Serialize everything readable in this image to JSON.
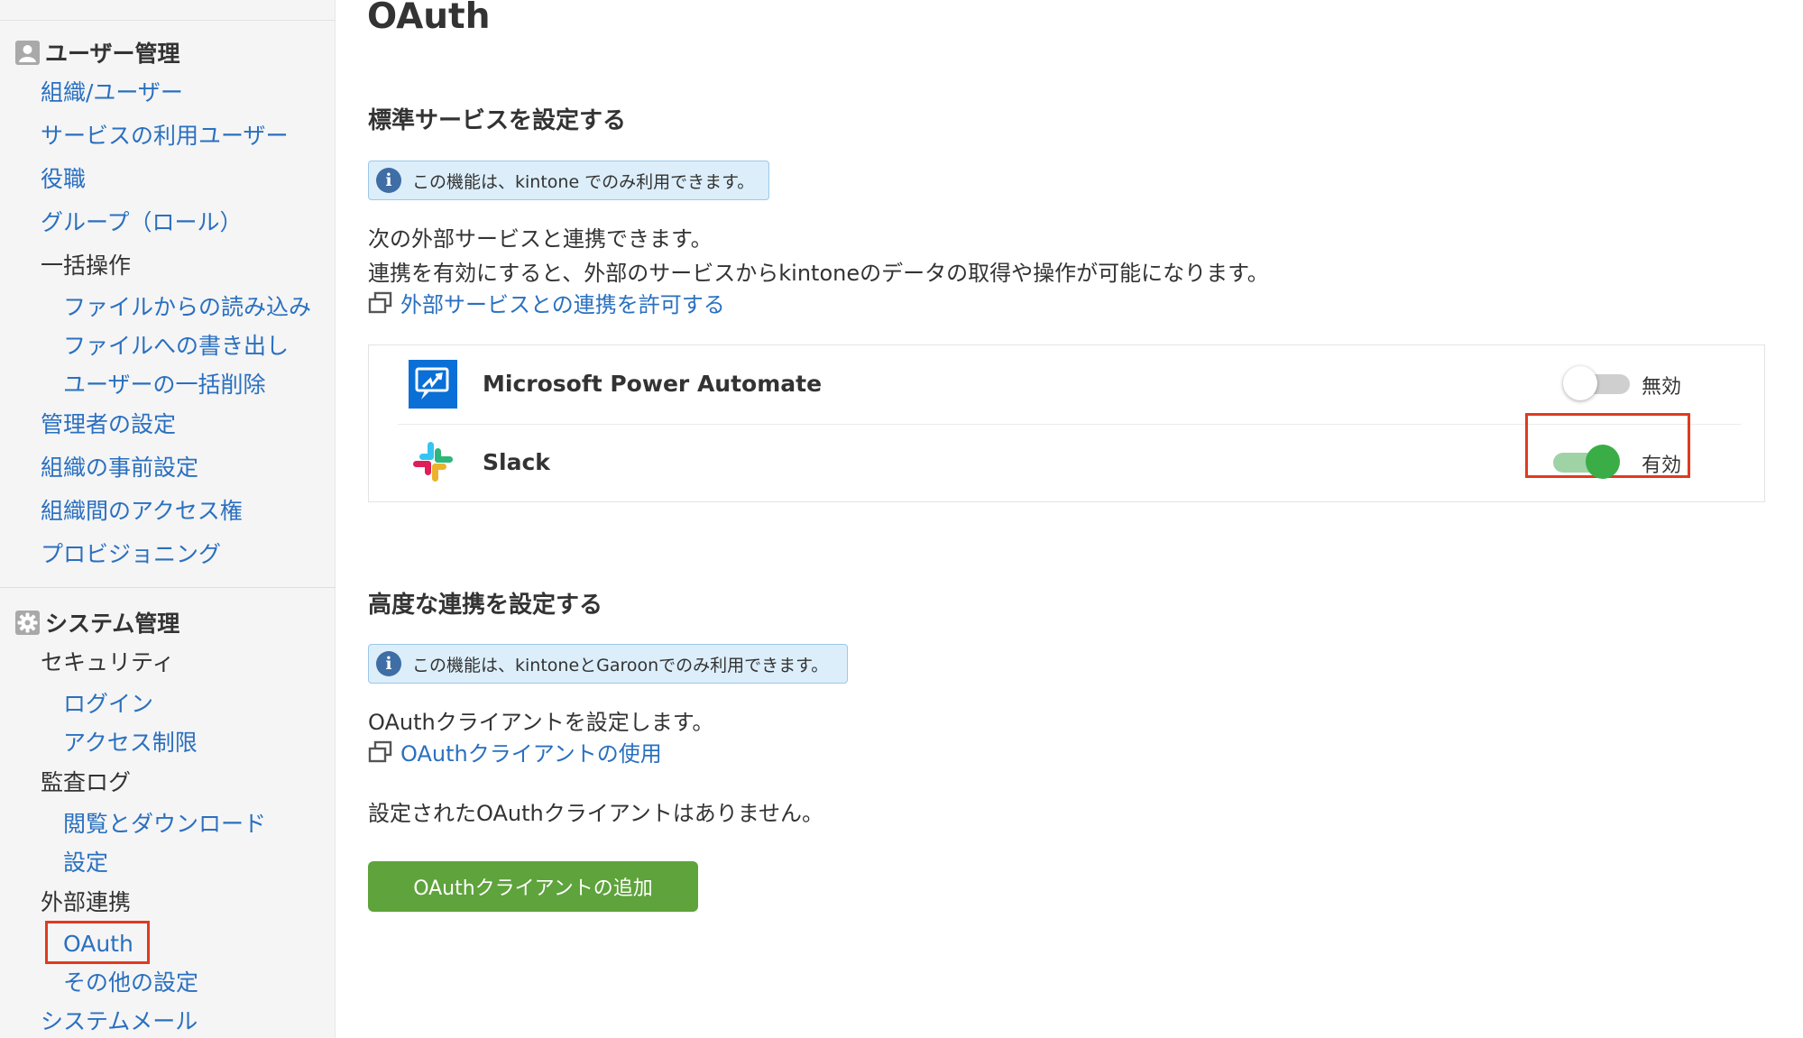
{
  "sidebar": {
    "user_section": {
      "label": "ユーザー管理",
      "icon": "user-icon"
    },
    "user_items": [
      {
        "label": "組織/ユーザー"
      },
      {
        "label": "サービスの利用ユーザー"
      },
      {
        "label": "役職"
      },
      {
        "label": "グループ（ロール）"
      },
      {
        "label": "一括操作"
      },
      {
        "label": "ファイルからの読み込み"
      },
      {
        "label": "ファイルへの書き出し"
      },
      {
        "label": "ユーザーの一括削除"
      },
      {
        "label": "管理者の設定"
      },
      {
        "label": "組織の事前設定"
      },
      {
        "label": "組織間のアクセス権"
      },
      {
        "label": "プロビジョニング"
      }
    ],
    "system_section": {
      "label": "システム管理",
      "icon": "gear-icon"
    },
    "system_items": [
      {
        "label": "セキュリティ"
      },
      {
        "label": "ログイン"
      },
      {
        "label": "アクセス制限"
      },
      {
        "label": "監査ログ"
      },
      {
        "label": "閲覧とダウンロード"
      },
      {
        "label": "設定"
      },
      {
        "label": "外部連携"
      },
      {
        "label": "OAuth"
      },
      {
        "label": "その他の設定"
      },
      {
        "label": "システムメール"
      }
    ]
  },
  "main": {
    "title": "OAuth",
    "standard": {
      "heading": "標準サービスを設定する",
      "info": "この機能は、kintone でのみ利用できます。",
      "desc1": "次の外部サービスと連携できます。",
      "desc2": "連携を有効にすると、外部のサービスからkintoneのデータの取得や操作が可能になります。",
      "link": "外部サービスとの連携を許可する",
      "services": [
        {
          "name": "Microsoft Power Automate",
          "state": "無効",
          "enabled": false,
          "icon": "power-automate-icon"
        },
        {
          "name": "Slack",
          "state": "有効",
          "enabled": true,
          "icon": "slack-icon"
        }
      ]
    },
    "advanced": {
      "heading": "高度な連携を設定する",
      "info": "この機能は、kintoneとGaroonでのみ利用できます。",
      "desc": "OAuthクライアントを設定します。",
      "link": "OAuthクライアントの使用",
      "empty": "設定されたOAuthクライアントはありません。",
      "add_button": "OAuthクライアントの追加"
    }
  },
  "colors": {
    "link": "#2a70c0",
    "highlight": "#e03a1f",
    "toggle_on": "#3aad46",
    "button": "#5ea33b",
    "info_bg": "#dceefa"
  }
}
